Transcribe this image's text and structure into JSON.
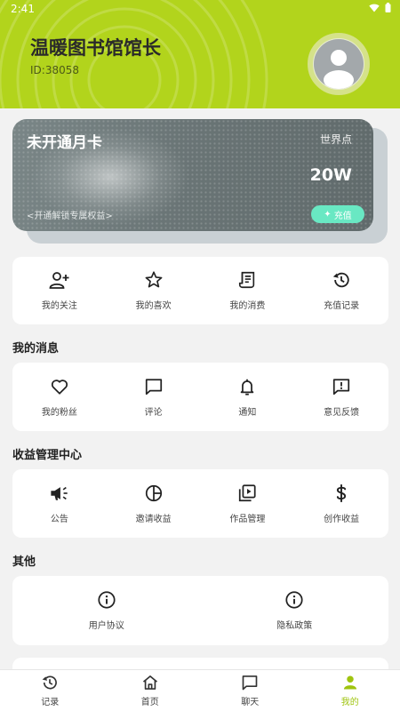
{
  "status": {
    "time": "2:41"
  },
  "profile": {
    "name": "温暖图书馆馆长",
    "id": "ID:38058"
  },
  "vip_card": {
    "title": "未开通月卡",
    "points_label": "世界点",
    "points_value": "20W",
    "hint": "<开通解锁专属权益>",
    "recharge_label": "充值"
  },
  "quick_actions": [
    {
      "label": "我的关注",
      "icon": "add-user-icon"
    },
    {
      "label": "我的喜欢",
      "icon": "star-icon"
    },
    {
      "label": "我的消费",
      "icon": "receipt-icon"
    },
    {
      "label": "充值记录",
      "icon": "history-icon"
    }
  ],
  "messages": {
    "title": "我的消息",
    "items": [
      {
        "label": "我的粉丝",
        "icon": "heart-icon"
      },
      {
        "label": "评论",
        "icon": "comment-icon"
      },
      {
        "label": "通知",
        "icon": "bell-icon"
      },
      {
        "label": "意见反馈",
        "icon": "feedback-icon"
      }
    ]
  },
  "earnings": {
    "title": "收益管理中心",
    "items": [
      {
        "label": "公告",
        "icon": "megaphone-icon"
      },
      {
        "label": "邀请收益",
        "icon": "pie-chart-icon"
      },
      {
        "label": "作品管理",
        "icon": "video-library-icon"
      },
      {
        "label": "创作收益",
        "icon": "dollar-icon"
      }
    ]
  },
  "others": {
    "title": "其他",
    "items": [
      {
        "label": "用户协议",
        "icon": "info-icon"
      },
      {
        "label": "隐私政策",
        "icon": "info-icon"
      }
    ]
  },
  "bottom_nav": [
    {
      "label": "记录",
      "icon": "history-icon",
      "active": false
    },
    {
      "label": "首页",
      "icon": "home-icon",
      "active": false
    },
    {
      "label": "聊天",
      "icon": "chat-icon",
      "active": false
    },
    {
      "label": "我的",
      "icon": "person-icon",
      "active": true
    }
  ],
  "colors": {
    "header_bg": "#b2d41c",
    "accent_active": "#9fc40f",
    "recharge_button": "#69e8c3",
    "page_bg": "#f2f2f2"
  }
}
